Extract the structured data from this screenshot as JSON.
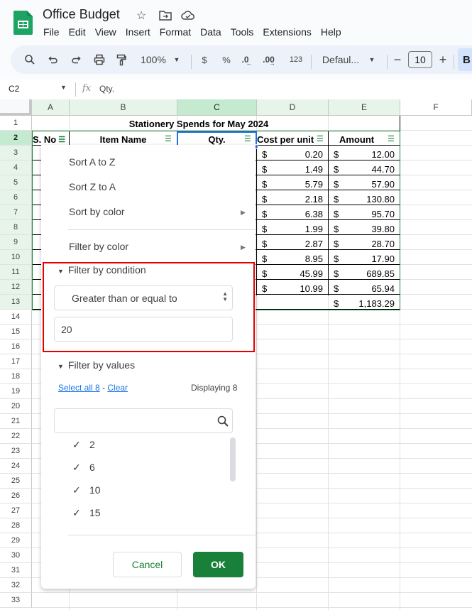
{
  "app": {
    "title": "Office Budget",
    "menus": [
      "File",
      "Edit",
      "View",
      "Insert",
      "Format",
      "Data",
      "Tools",
      "Extensions",
      "Help"
    ]
  },
  "toolbar": {
    "zoom": "100%",
    "currency": "$",
    "percent": "%",
    "dec_decrease": ".0",
    "dec_increase": ".00",
    "more_formats": "123",
    "font": "Defaul...",
    "font_size": "10",
    "bold": "B"
  },
  "formula_bar": {
    "name_box": "C2",
    "fx": "fx",
    "value": "Qty."
  },
  "columns": [
    "A",
    "B",
    "C",
    "D",
    "E",
    "F"
  ],
  "rows": [
    "1",
    "2",
    "3",
    "4",
    "5",
    "6",
    "7",
    "8",
    "9",
    "10",
    "11",
    "12",
    "13",
    "14",
    "15",
    "16",
    "17",
    "18",
    "19",
    "20",
    "21",
    "22",
    "23",
    "24",
    "25",
    "26",
    "27",
    "28",
    "29",
    "30",
    "31",
    "32",
    "33"
  ],
  "sheet": {
    "title": "Stationery Spends for May 2024",
    "headers": [
      "S. No",
      "Item Name",
      "Qty.",
      "Cost per unit",
      "Amount"
    ],
    "currency_symbol": "$",
    "cost_per_unit": [
      "0.20",
      "1.49",
      "5.79",
      "2.18",
      "6.38",
      "1.99",
      "2.87",
      "8.95",
      "45.99",
      "10.99"
    ],
    "amount": [
      "12.00",
      "44.70",
      "57.90",
      "130.80",
      "95.70",
      "39.80",
      "28.70",
      "17.90",
      "689.85",
      "65.94"
    ],
    "total": "1,183.29"
  },
  "filter_menu": {
    "sort_az": "Sort A to Z",
    "sort_za": "Sort Z to A",
    "sort_color": "Sort by color",
    "filter_color": "Filter by color",
    "filter_condition": "Filter by condition",
    "condition": "Greater than or equal to",
    "condition_value": "20",
    "filter_values": "Filter by values",
    "select_all": "Select all 8",
    "dash": " - ",
    "clear": "Clear",
    "displaying": "Displaying 8",
    "search_placeholder": "",
    "values": [
      {
        "label": "2",
        "checked": true
      },
      {
        "label": "6",
        "checked": true
      },
      {
        "label": "10",
        "checked": true
      },
      {
        "label": "15",
        "checked": true
      }
    ],
    "cancel": "Cancel",
    "ok": "OK"
  },
  "colors": {
    "accent_green": "#188038",
    "highlight_red": "#e60000",
    "link_blue": "#1a73e8"
  }
}
